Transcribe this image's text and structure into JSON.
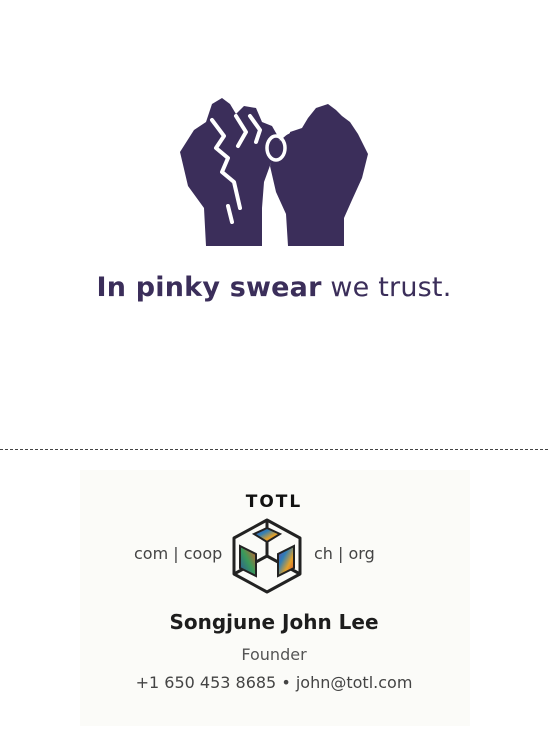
{
  "flyer": {
    "tagline_bold": "In pinky swear",
    "tagline_rest": " we trust.",
    "illustration_icon": "pinky-swear-fists-icon",
    "accent_color": "#3b2e5a"
  },
  "card": {
    "brand": "TOTL",
    "logo_icon": "cube-logo-icon",
    "tld_left": "com | coop",
    "tld_right": "ch | org",
    "name": "Songjune John Lee",
    "role": "Founder",
    "phone": "+1 650 453 8685",
    "separator": " • ",
    "email": "john@totl.com"
  }
}
